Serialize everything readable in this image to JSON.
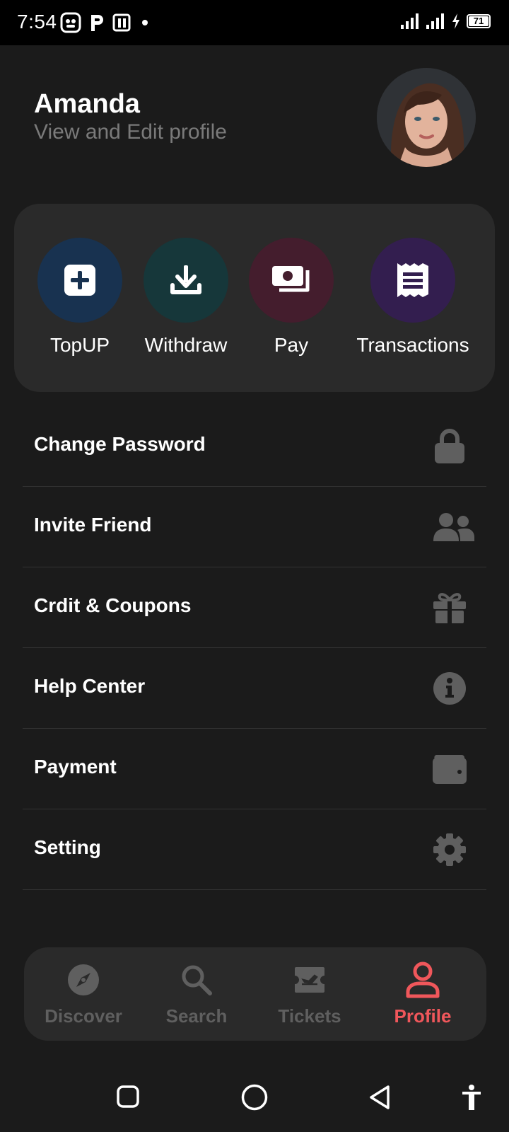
{
  "status_bar": {
    "time": "7:54",
    "battery": "71"
  },
  "header": {
    "name": "Amanda",
    "subtitle": "View and Edit profile"
  },
  "quick_actions": [
    {
      "label": "TopUP",
      "icon": "plus-square-icon",
      "color": "#183250"
    },
    {
      "label": "Withdraw",
      "icon": "download-icon",
      "color": "#16373a"
    },
    {
      "label": "Pay",
      "icon": "money-bills-icon",
      "color": "#441d2d"
    },
    {
      "label": "Transactions",
      "icon": "receipt-icon",
      "color": "#331e4f"
    }
  ],
  "menu": [
    {
      "label": "Change Password",
      "icon": "lock-icon"
    },
    {
      "label": "Invite Friend",
      "icon": "users-icon"
    },
    {
      "label": "Crdit & Coupons",
      "icon": "gift-icon"
    },
    {
      "label": "Help Center",
      "icon": "info-icon"
    },
    {
      "label": "Payment",
      "icon": "wallet-icon"
    },
    {
      "label": "Setting",
      "icon": "gear-icon"
    }
  ],
  "bottom_nav": [
    {
      "label": "Discover",
      "icon": "compass-icon",
      "active": false
    },
    {
      "label": "Search",
      "icon": "search-icon",
      "active": false
    },
    {
      "label": "Tickets",
      "icon": "ticket-icon",
      "active": false
    },
    {
      "label": "Profile",
      "icon": "user-icon",
      "active": true
    }
  ],
  "colors": {
    "background": "#1b1b1b",
    "card": "#2a2a2a",
    "accent": "#f0575b",
    "muted": "#5f5f5f"
  }
}
